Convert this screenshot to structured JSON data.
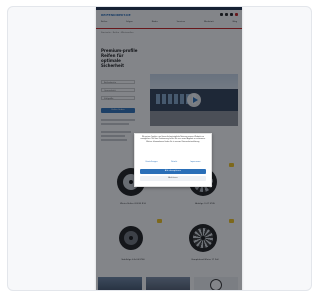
{
  "header": {
    "logo": "REIFENDIREKT.DE",
    "nav": [
      "Reifen",
      "Felgen",
      "Räder",
      "Services",
      "Werkstatt",
      "Blog"
    ]
  },
  "breadcrumb": "Startseite › Reifen › Winterreifen",
  "hero": {
    "title": "Premium-profile Reifen für optimale Sicherheit"
  },
  "form": {
    "field_1": "Reifenbreite",
    "field_2": "Querschnitt",
    "field_3": "Zollgröße",
    "cta": "Reifen finden"
  },
  "cookie_modal": {
    "text": "Wir nutzen Cookies, um Ihnen die bestmögliche Nutzung unserer Webseite zu ermöglichen. Mit Ihrer Zustimmung helfen Sie uns, unser Angebot zu verbessern. Weitere Informationen finden Sie in unserer Datenschutzerklärung.",
    "links": [
      "Einstellungen",
      "Details",
      "Impressum"
    ],
    "accept_label": "Alle akzeptieren",
    "decline_label": "Ablehnen"
  },
  "products": [
    {
      "label": "Winter Reifen 205/55 R16"
    },
    {
      "label": "Alufelge 7x17 ET45"
    },
    {
      "label": "Stahlfelge 6.5x16 ET40"
    },
    {
      "label": "Komplettrad Winter 17 Zoll"
    }
  ],
  "colors": {
    "brand": "#2a6fb8",
    "accent": "#c61d1d",
    "badge": "#f2c21b",
    "dark": "#1d2e4f"
  }
}
